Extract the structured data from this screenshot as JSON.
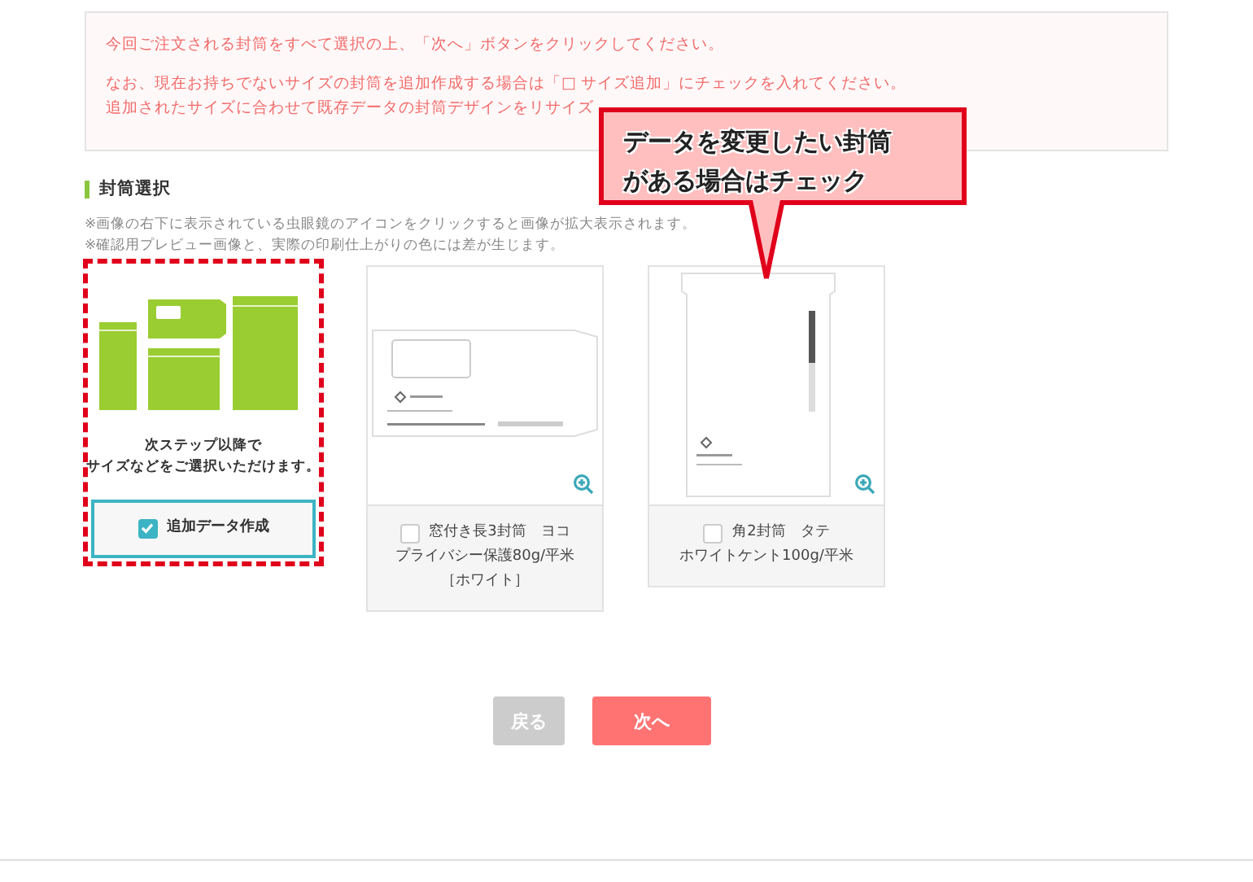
{
  "notice": {
    "paragraphs": [
      [
        "今回ご注文される封筒をすべて選択の上、「次へ」ボタンをクリックしてください。"
      ],
      [
        "なお、現在お持ちでないサイズの封筒を追加作成する場合は「□ サイズ追加」にチェックを入れてください。",
        "追加されたサイズに合わせて既存データの封筒デザインをリサイズ"
      ]
    ]
  },
  "section": {
    "title": "封筒選択",
    "notes": [
      "※画像の右下に表示されている虫眼鏡のアイコンをクリックすると画像が拡大表示されます。",
      "※確認用プレビュー画像と、実際の印刷仕上がりの色には差が生じます。"
    ]
  },
  "cards": [
    {
      "kind": "add",
      "selected": true,
      "checked": true,
      "caption": [
        "次ステップ以降で",
        "サイズなどをご選択いただけます。"
      ],
      "label": [
        "追加データ作成"
      ]
    },
    {
      "kind": "horizontal",
      "selected": false,
      "checked": false,
      "label": [
        "窓付き長3封筒　ヨコ",
        "プライバシー保護80g/平米",
        "［ホワイト］"
      ]
    },
    {
      "kind": "vertical",
      "selected": false,
      "checked": false,
      "label": [
        "角2封筒　タテ",
        "ホワイトケント100g/平米"
      ]
    }
  ],
  "callout": {
    "lines": [
      "データを変更したい封筒",
      "がある場合はチェック"
    ]
  },
  "buttons": [
    {
      "kind": "back",
      "label": "戻る"
    },
    {
      "kind": "next",
      "label": "次へ"
    }
  ]
}
